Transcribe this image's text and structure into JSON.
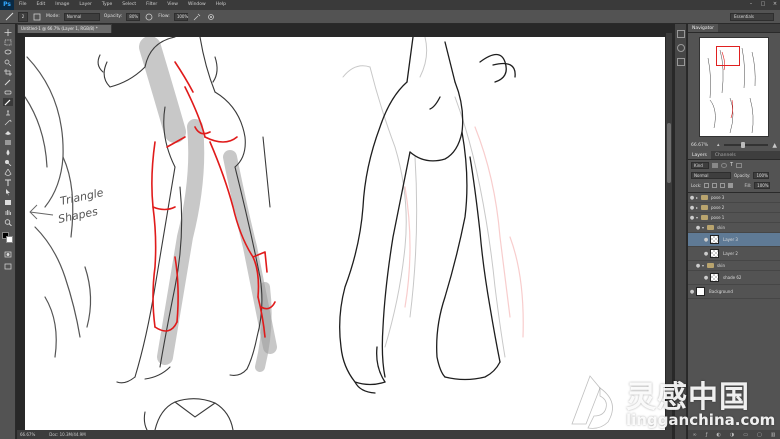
{
  "app": {
    "logo": "Ps"
  },
  "menu": [
    "File",
    "Edit",
    "Image",
    "Layer",
    "Type",
    "Select",
    "Filter",
    "View",
    "Window",
    "Help"
  ],
  "window_controls": [
    "–",
    "□",
    "×"
  ],
  "options": {
    "brush_size": "2",
    "mode_label": "Mode:",
    "mode_value": "Normal",
    "opacity_label": "Opacity:",
    "opacity_value": "80%",
    "flow_label": "Flow:",
    "flow_value": "100%",
    "workspace": "Essentials"
  },
  "document": {
    "tab_title": "Untitled-1 @ 66.7% (Layer 1, RGB/8) *",
    "zoom": "66.67%",
    "doc_size": "Doc: 10.3M/44.9M"
  },
  "canvas_annotation": {
    "line1": "Triangle",
    "line2": "Shapes"
  },
  "navigator": {
    "tabs": [
      "Navigator"
    ],
    "zoom": "66.67%"
  },
  "layers": {
    "tabs": [
      "Layers",
      "Channels"
    ],
    "kind_label": "Kind",
    "blend_mode": "Normal",
    "opacity_label": "Opacity:",
    "opacity_value": "100%",
    "lock_label": "Lock:",
    "fill_label": "Fill:",
    "fill_value": "100%",
    "items": [
      {
        "name": "pose 3",
        "type": "group",
        "selected": false
      },
      {
        "name": "pose 2",
        "type": "group",
        "selected": false
      },
      {
        "name": "pose 1",
        "type": "group",
        "selected": false
      },
      {
        "name": "skin",
        "type": "group",
        "selected": false
      },
      {
        "name": "Layer 3",
        "type": "layer",
        "selected": true
      },
      {
        "name": "Layer 2",
        "type": "layer",
        "selected": false
      },
      {
        "name": "skin",
        "type": "group",
        "selected": false
      },
      {
        "name": "shade 62",
        "type": "layer",
        "selected": false
      },
      {
        "name": "Background",
        "type": "layer",
        "selected": false
      }
    ],
    "bottom_icons": [
      "link-icon",
      "fx-icon",
      "mask-icon",
      "adjustment-icon",
      "folder-icon",
      "new-layer-icon",
      "trash-icon"
    ]
  },
  "watermark": {
    "cn": "灵感中国",
    "en": "lingganchina.com"
  },
  "colors": {
    "accent": "#31a8ff",
    "selected_layer": "#5f7a95",
    "sketch_red": "#e01b1b"
  }
}
